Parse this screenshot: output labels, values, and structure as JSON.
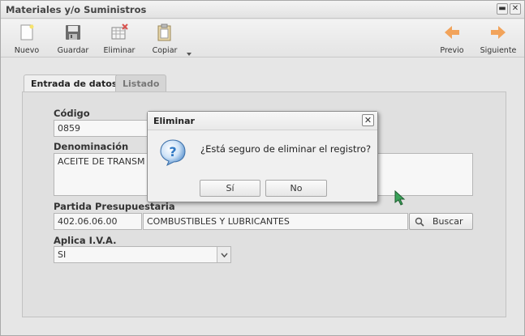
{
  "window": {
    "title": "Materiales y/o Suministros",
    "minimize_glyph": "▬",
    "close_glyph": "✕"
  },
  "toolbar": {
    "nuevo": "Nuevo",
    "guardar": "Guardar",
    "eliminar": "Eliminar",
    "copiar": "Copiar",
    "previo": "Previo",
    "siguiente": "Siguiente"
  },
  "tabs": [
    {
      "label": "Entrada de datos",
      "active": true
    },
    {
      "label": "Listado",
      "active": false
    }
  ],
  "form": {
    "codigo_label": "Código",
    "codigo_value": "0859",
    "denominacion_label": "Denominación",
    "denominacion_value": "ACEITE DE TRANSM",
    "partida_label": "Partida Presupuestaria",
    "partida_code": "402.06.06.00",
    "partida_desc": "COMBUSTIBLES Y LUBRICANTES",
    "buscar_label": "Buscar",
    "iva_label": "Aplica I.V.A.",
    "iva_value": "SI"
  },
  "dialog": {
    "title": "Eliminar",
    "message": "¿Está seguro de eliminar el registro?",
    "yes_label": "Sí",
    "no_label": "No",
    "close_glyph": "✕",
    "icon_glyph": "?"
  },
  "colors": {
    "arrow_orange": "#f2a35a",
    "question_blue": "#2f78c4",
    "eraser_red": "#d9534f"
  }
}
